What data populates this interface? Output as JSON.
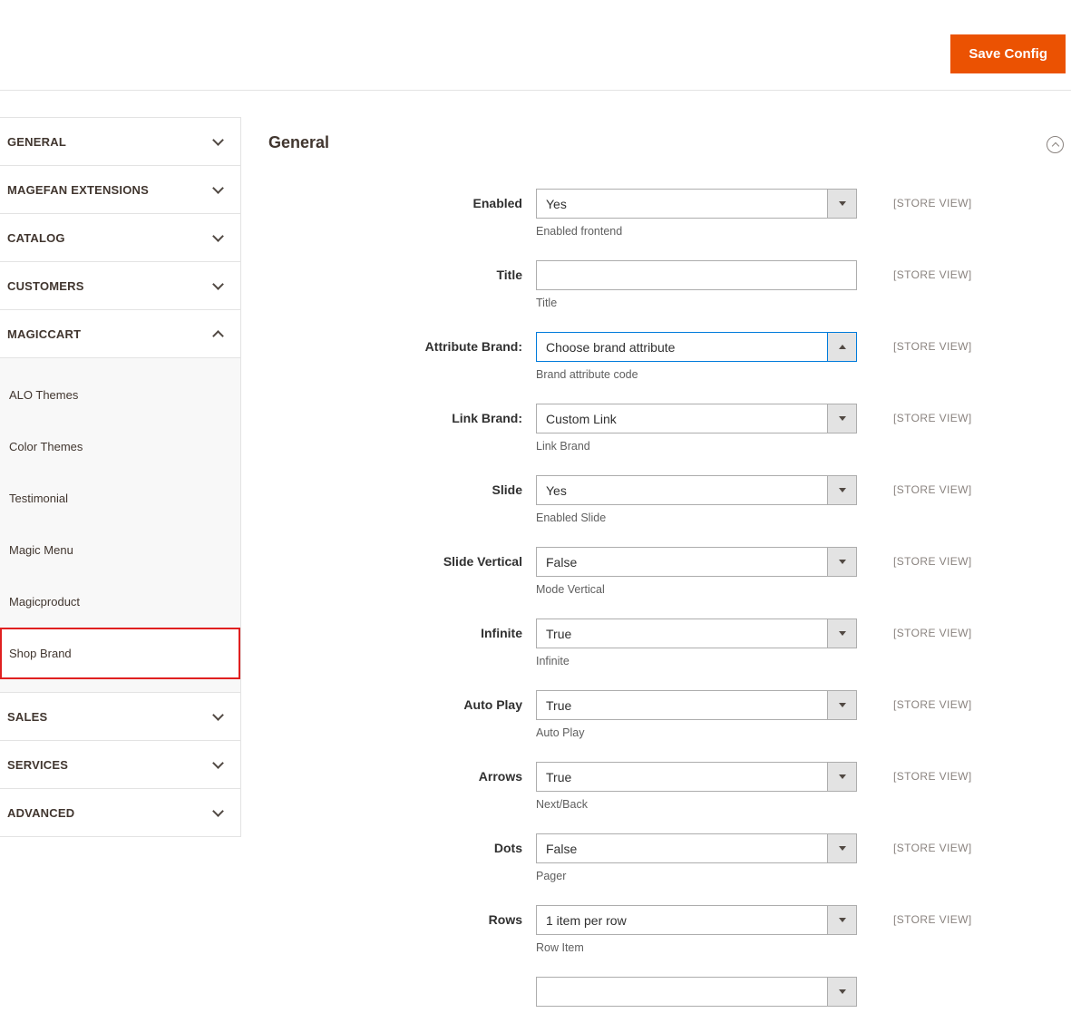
{
  "colors": {
    "accent_orange": "#eb5202",
    "focus_blue": "#007bdb",
    "highlight_red": "#e02020",
    "sidebar_text": "#41362f"
  },
  "header": {
    "save_button_label": "Save Config"
  },
  "sidebar": {
    "selected_item": "Shop Brand",
    "sections": [
      {
        "label": "GENERAL",
        "expanded": false
      },
      {
        "label": "MAGEFAN EXTENSIONS",
        "expanded": false
      },
      {
        "label": "CATALOG",
        "expanded": false
      },
      {
        "label": "CUSTOMERS",
        "expanded": false
      },
      {
        "label": "MAGICCART",
        "expanded": true,
        "items": [
          "ALO Themes",
          "Color Themes",
          "Testimonial",
          "Magic Menu",
          "Magicproduct",
          "Shop Brand"
        ]
      },
      {
        "label": "SALES",
        "expanded": false
      },
      {
        "label": "SERVICES",
        "expanded": false
      },
      {
        "label": "ADVANCED",
        "expanded": false
      }
    ]
  },
  "main": {
    "section_title": "General",
    "fields": [
      {
        "label": "Enabled",
        "type": "select",
        "value": "Yes",
        "note": "Enabled frontend",
        "scope": "[STORE VIEW]"
      },
      {
        "label": "Title",
        "type": "text",
        "value": "",
        "note": "Title",
        "scope": "[STORE VIEW]"
      },
      {
        "label": "Attribute Brand:",
        "type": "select",
        "value": "Choose brand attribute",
        "note": "Brand attribute code",
        "scope": "[STORE VIEW]",
        "focused": true
      },
      {
        "label": "Link Brand:",
        "type": "select",
        "value": "Custom Link",
        "note": "Link Brand",
        "scope": "[STORE VIEW]"
      },
      {
        "label": "Slide",
        "type": "select",
        "value": "Yes",
        "note": "Enabled Slide",
        "scope": "[STORE VIEW]"
      },
      {
        "label": "Slide Vertical",
        "type": "select",
        "value": "False",
        "note": "Mode Vertical",
        "scope": "[STORE VIEW]"
      },
      {
        "label": "Infinite",
        "type": "select",
        "value": "True",
        "note": "Infinite",
        "scope": "[STORE VIEW]"
      },
      {
        "label": "Auto Play",
        "type": "select",
        "value": "True",
        "note": "Auto Play",
        "scope": "[STORE VIEW]"
      },
      {
        "label": "Arrows",
        "type": "select",
        "value": "True",
        "note": "Next/Back",
        "scope": "[STORE VIEW]"
      },
      {
        "label": "Dots",
        "type": "select",
        "value": "False",
        "note": "Pager",
        "scope": "[STORE VIEW]"
      },
      {
        "label": "Rows",
        "type": "select",
        "value": "1 item per row",
        "note": "Row Item",
        "scope": "[STORE VIEW]"
      },
      {
        "label": "",
        "type": "select",
        "value": "",
        "note": "",
        "scope": ""
      }
    ]
  }
}
